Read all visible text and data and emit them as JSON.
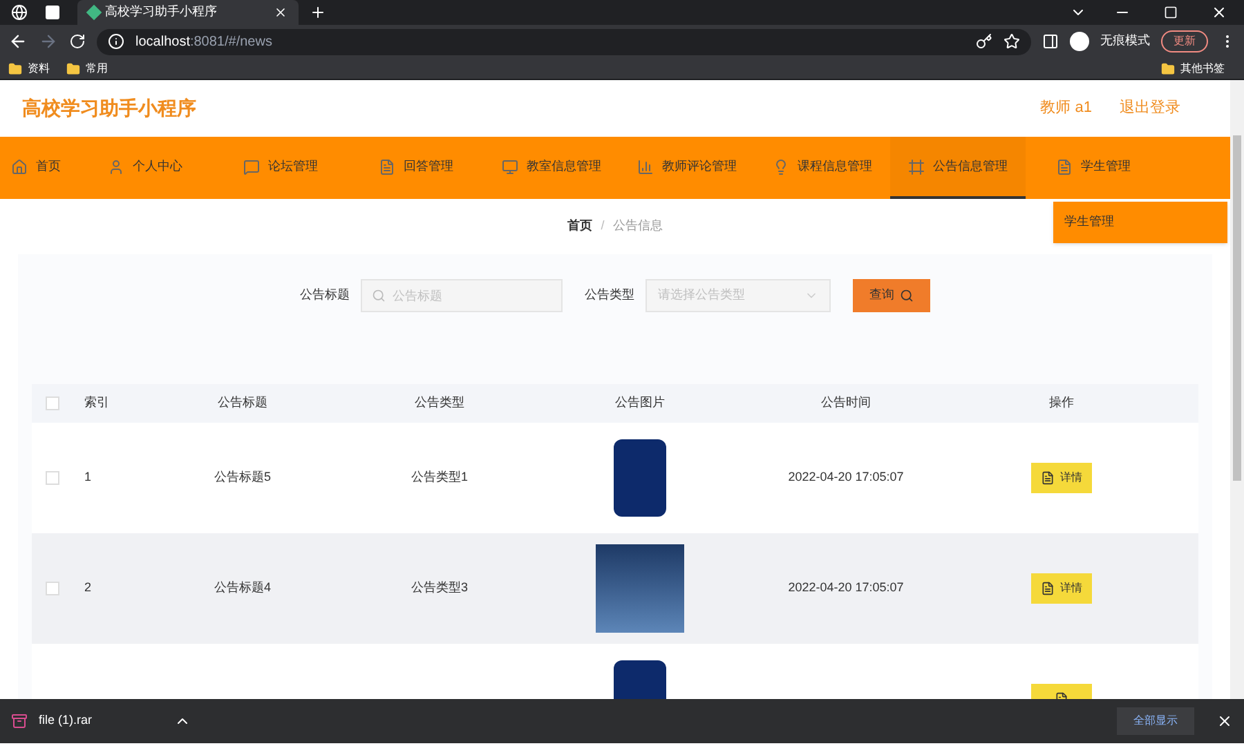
{
  "browser": {
    "tab_title": "高校学习助手小程序",
    "url_host": "localhost",
    "url_rest": ":8081/#/news",
    "incognito": "无痕模式",
    "update": "更新",
    "bookmarks": [
      "资料",
      "常用"
    ],
    "other_bookmarks": "其他书签"
  },
  "header": {
    "title": "高校学习助手小程序",
    "user": "教师 a1",
    "logout": "退出登录"
  },
  "nav": [
    {
      "label": "首页",
      "selected": false
    },
    {
      "label": "个人中心",
      "selected": false
    },
    {
      "label": "论坛管理",
      "selected": false
    },
    {
      "label": "回答管理",
      "selected": false
    },
    {
      "label": "教室信息管理",
      "selected": false
    },
    {
      "label": "教师评论管理",
      "selected": false
    },
    {
      "label": "课程信息管理",
      "selected": false
    },
    {
      "label": "公告信息管理",
      "selected": true
    },
    {
      "label": "学生管理",
      "selected": false
    }
  ],
  "dropdown": [
    "学生管理"
  ],
  "breadcrumb": [
    "首页",
    "/",
    "公告信息"
  ],
  "search": {
    "title_label": "公告标题",
    "title_placeholder": "公告标题",
    "type_label": "公告类型",
    "type_placeholder": "请选择公告类型",
    "button": "查询"
  },
  "table": {
    "all_checked": false,
    "columns": [
      "索引",
      "公告标题",
      "公告类型",
      "公告图片",
      "公告时间",
      "操作"
    ],
    "rows": [
      {
        "index": "1",
        "title": "公告标题5",
        "type": "公告类型1",
        "time": "2022-04-20 17:05:07",
        "action": "详情",
        "checked": false
      },
      {
        "index": "2",
        "title": "公告标题4",
        "type": "公告类型3",
        "time": "2022-04-20 17:05:07",
        "action": "详情",
        "checked": false
      },
      {}
    ]
  },
  "download": {
    "file": "file (1).rar",
    "show_all": "全部显示"
  }
}
